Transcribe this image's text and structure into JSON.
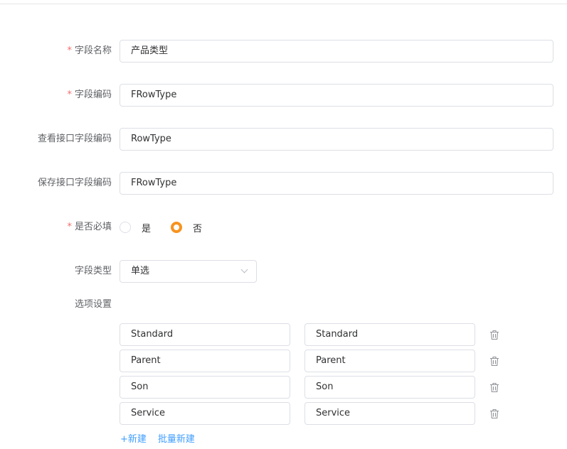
{
  "form": {
    "field_name": {
      "label": "字段名称",
      "required": "*",
      "value": "产品类型"
    },
    "field_code": {
      "label": "字段编码",
      "required": "*",
      "value": "FRowType"
    },
    "query_api_code": {
      "label": "查看接口字段编码",
      "value": "RowType"
    },
    "save_api_code": {
      "label": "保存接口字段编码",
      "value": "FRowType"
    },
    "is_required": {
      "label": "是否必填",
      "required": "*",
      "options": [
        "是",
        "否"
      ],
      "selected": "否"
    },
    "field_type": {
      "label": "字段类型",
      "value": "单选"
    },
    "options_setting": {
      "label": "选项设置"
    }
  },
  "options": [
    {
      "text": "Standard",
      "value": "Standard"
    },
    {
      "text": "Parent",
      "value": "Parent"
    },
    {
      "text": "Son",
      "value": "Son"
    },
    {
      "text": "Service",
      "value": "Service"
    }
  ],
  "actions": {
    "add_label": "+新建",
    "batch_add_label": "批量新建"
  },
  "colors": {
    "accent": "#f7931e",
    "link": "#409eff",
    "required": "#f56c6c",
    "border": "#dcdfe6"
  },
  "icons": {
    "delete": "trash-icon",
    "dropdown": "chevron-down-icon"
  }
}
